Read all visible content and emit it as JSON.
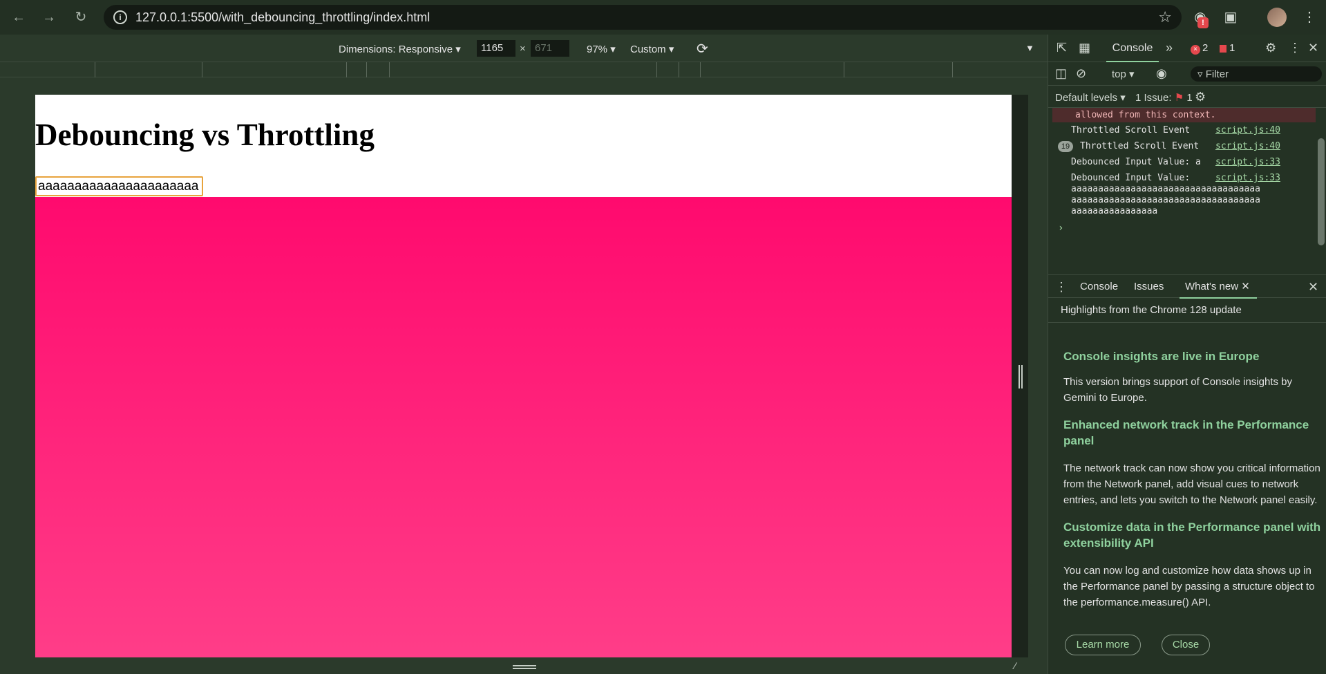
{
  "browser": {
    "url": "127.0.0.1:5500/with_debouncing_throttling/index.html",
    "extension_badge": "!"
  },
  "device_toolbar": {
    "dimensions_label": "Dimensions: Responsive",
    "width": "1165",
    "height": "671",
    "zoom": "97%",
    "throttle": "Custom"
  },
  "page": {
    "title": "Debouncing vs Throttling",
    "input_value": "aaaaaaaaaaaaaaaaaaaaaa",
    "gradient_colors": [
      "#ff0a6e",
      "#ff3d88"
    ]
  },
  "devtools": {
    "tab_console": "Console",
    "error_count": "2",
    "issue_count": "1",
    "context": "top",
    "filter_placeholder": "Filter",
    "levels": "Default levels",
    "issues_label": "1 Issue:",
    "issues_count": "1",
    "logs": [
      {
        "kind": "error",
        "text": "allowed from this context."
      },
      {
        "kind": "log",
        "text": "Throttled Scroll Event",
        "link": "script.js:40"
      },
      {
        "kind": "log",
        "text": "Throttled Scroll Event",
        "link": "script.js:40",
        "repeat": "19"
      },
      {
        "kind": "log",
        "text": "Debounced Input Value: a",
        "link": "script.js:33"
      },
      {
        "kind": "log",
        "text": "Debounced Input Value:",
        "link": "script.js:33",
        "continuation": [
          "aaaaaaaaaaaaaaaaaaaaaaaaaaaaaaaaaaa",
          "aaaaaaaaaaaaaaaaaaaaaaaaaaaaaaaaaaa",
          "aaaaaaaaaaaaaaaa"
        ]
      }
    ],
    "prompt_symbol": "›"
  },
  "drawer": {
    "tab_console": "Console",
    "tab_issues": "Issues",
    "tab_whats_new": "What's new",
    "header": "Highlights from the Chrome 128 update",
    "sections": [
      {
        "heading": "Console insights are live in Europe",
        "body": "This version brings support of Console insights by Gemini to Europe."
      },
      {
        "heading": "Enhanced network track in the Performance panel",
        "body": "The network track can now show you critical information from the Network panel, add visual cues to network entries, and lets you switch to the Network panel easily."
      },
      {
        "heading": "Customize data in the Performance panel with extensibility API",
        "body": "You can now log and customize how data shows up in the Performance panel by passing a structure object to the performance.measure() API."
      }
    ],
    "learn_more": "Learn more",
    "close": "Close"
  },
  "theme": {
    "accent": "#8fd19e",
    "link": "#a8dba8",
    "error": "#e5484d"
  }
}
